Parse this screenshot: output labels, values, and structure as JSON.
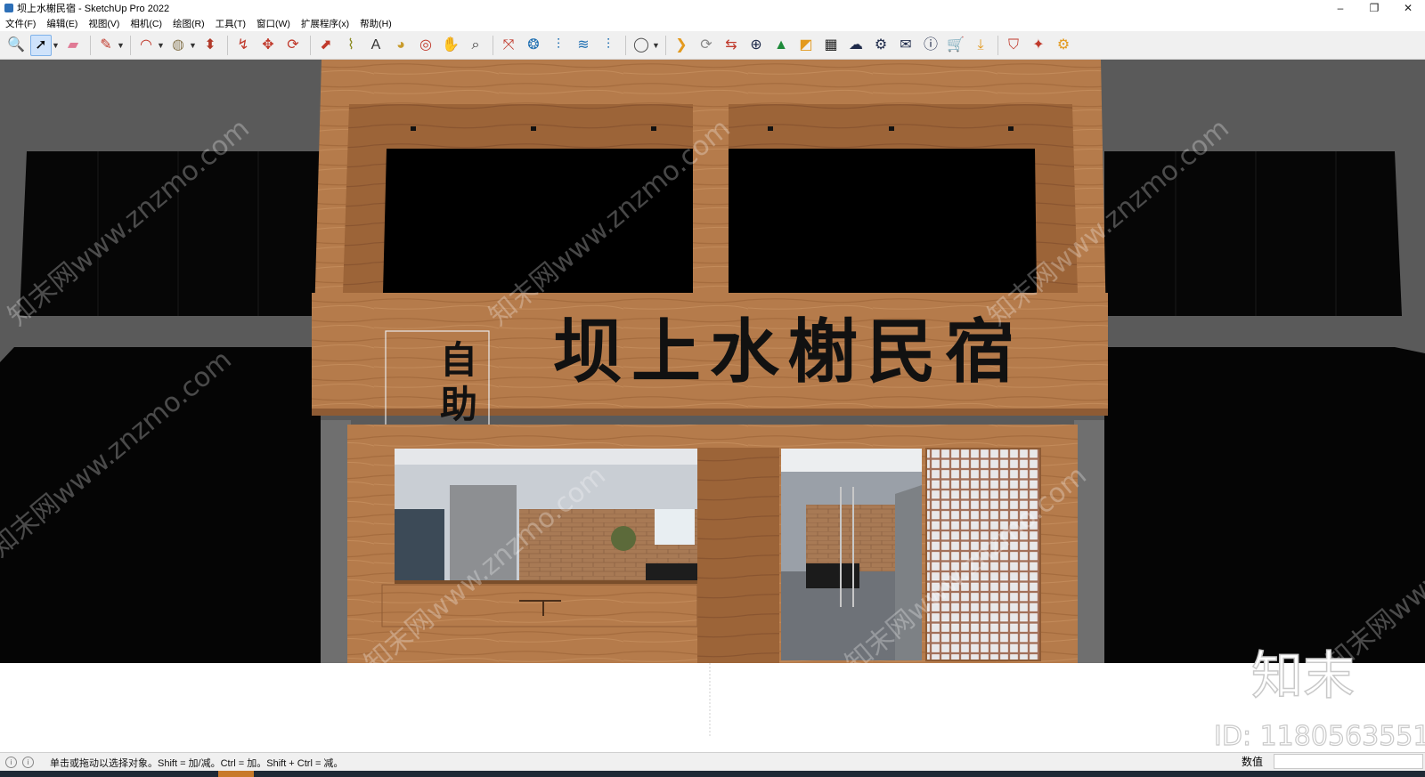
{
  "window": {
    "title": "坝上水榭民宿 - SketchUp Pro 2022",
    "controls": {
      "minimize": "–",
      "restore": "❐",
      "close": "✕"
    }
  },
  "menu": {
    "items": [
      "文件(F)",
      "编辑(E)",
      "视图(V)",
      "相机(C)",
      "绘图(R)",
      "工具(T)",
      "窗口(W)",
      "扩展程序(x)",
      "帮助(H)"
    ]
  },
  "toolbar": {
    "tools": [
      {
        "name": "zoom-icon",
        "glyph": "🔍",
        "color": "#333333"
      },
      {
        "name": "select-icon",
        "glyph": "➚",
        "color": "#000000",
        "active": true,
        "dropdown": true
      },
      {
        "name": "eraser-icon",
        "glyph": "▰",
        "color": "#e07a95"
      },
      {
        "name": "pencil-icon",
        "glyph": "✎",
        "color": "#c0392b",
        "dropdown": true
      },
      {
        "name": "arc-icon",
        "glyph": "◠",
        "color": "#c0392b",
        "dropdown": true
      },
      {
        "name": "paint-bucket-icon",
        "glyph": "◍",
        "color": "#8a7a55",
        "dropdown": true
      },
      {
        "name": "push-pull-icon",
        "glyph": "⬍",
        "color": "#b23a2a"
      },
      {
        "name": "follow-me-icon",
        "glyph": "↯",
        "color": "#c0392b"
      },
      {
        "name": "move-icon",
        "glyph": "✥",
        "color": "#c0392b"
      },
      {
        "name": "rotate-icon",
        "glyph": "⟳",
        "color": "#c0392b"
      },
      {
        "name": "scale-icon",
        "glyph": "⬈",
        "color": "#c0392b"
      },
      {
        "name": "tape-measure-icon",
        "glyph": "⌇",
        "color": "#8a8a20"
      },
      {
        "name": "text-icon",
        "glyph": "A",
        "color": "#333333"
      },
      {
        "name": "paint-icon",
        "glyph": "◕",
        "color": "#c89a2a"
      },
      {
        "name": "orbit-icon",
        "glyph": "◎",
        "color": "#c0392b"
      },
      {
        "name": "pan-icon",
        "glyph": "✋",
        "color": "#d6a94a"
      },
      {
        "name": "zoom-window-icon",
        "glyph": "⌕",
        "color": "#333333"
      },
      {
        "name": "zoom-extents-icon",
        "glyph": "⤧",
        "color": "#c0392b"
      },
      {
        "name": "warehouse-icon",
        "glyph": "❂",
        "color": "#1f6fb2"
      },
      {
        "name": "extension-icon",
        "glyph": "⫶",
        "color": "#1f6fb2"
      },
      {
        "name": "layers-icon",
        "glyph": "≋",
        "color": "#1f6fb2"
      },
      {
        "name": "styles-icon",
        "glyph": "⫶",
        "color": "#1f6fb2"
      },
      {
        "name": "account-icon",
        "glyph": "◯",
        "color": "#555555",
        "dropdown": true
      },
      {
        "name": "plugin-orange-icon",
        "glyph": "❯",
        "color": "#e39a1f"
      },
      {
        "name": "refresh-icon",
        "glyph": "⟳",
        "color": "#888888"
      },
      {
        "name": "transfer-icon",
        "glyph": "⇆",
        "color": "#c0392b"
      },
      {
        "name": "add-circle-icon",
        "glyph": "⊕",
        "color": "#1e2a4a"
      },
      {
        "name": "tree-icon",
        "glyph": "▲",
        "color": "#1e8a3a"
      },
      {
        "name": "layout-icon",
        "glyph": "◩",
        "color": "#e39a1f"
      },
      {
        "name": "checker-icon",
        "glyph": "▦",
        "color": "#222222"
      },
      {
        "name": "cloud-upload-icon",
        "glyph": "☁",
        "color": "#1e2a4a"
      },
      {
        "name": "settings-gear-icon",
        "glyph": "⚙",
        "color": "#1e2a4a"
      },
      {
        "name": "mail-icon",
        "glyph": "✉",
        "color": "#1e2a4a"
      },
      {
        "name": "info-icon",
        "glyph": "ⓘ",
        "color": "#1e2a4a"
      },
      {
        "name": "cart-icon",
        "glyph": "🛒",
        "color": "#1e2a4a"
      },
      {
        "name": "download-icon",
        "glyph": "⤓",
        "color": "#e39a1f"
      },
      {
        "name": "shield-icon",
        "glyph": "⛉",
        "color": "#c0392b"
      },
      {
        "name": "rocket-icon",
        "glyph": "✦",
        "color": "#c0392b"
      },
      {
        "name": "cog-icon",
        "glyph": "⚙",
        "color": "#e39a1f"
      }
    ]
  },
  "scene": {
    "sign_main": "坝上水榭民宿",
    "sign_side_top": "自",
    "sign_side_bottom": "助",
    "watermark_repeat": "知末网www.znzmo.com",
    "watermark_logo": "知末",
    "watermark_id": "ID: 1180563551"
  },
  "status": {
    "hint": "单击或拖动以选择对象。Shift = 加/减。Ctrl = 加。Shift + Ctrl = 减。",
    "measurements_label": "数值"
  }
}
